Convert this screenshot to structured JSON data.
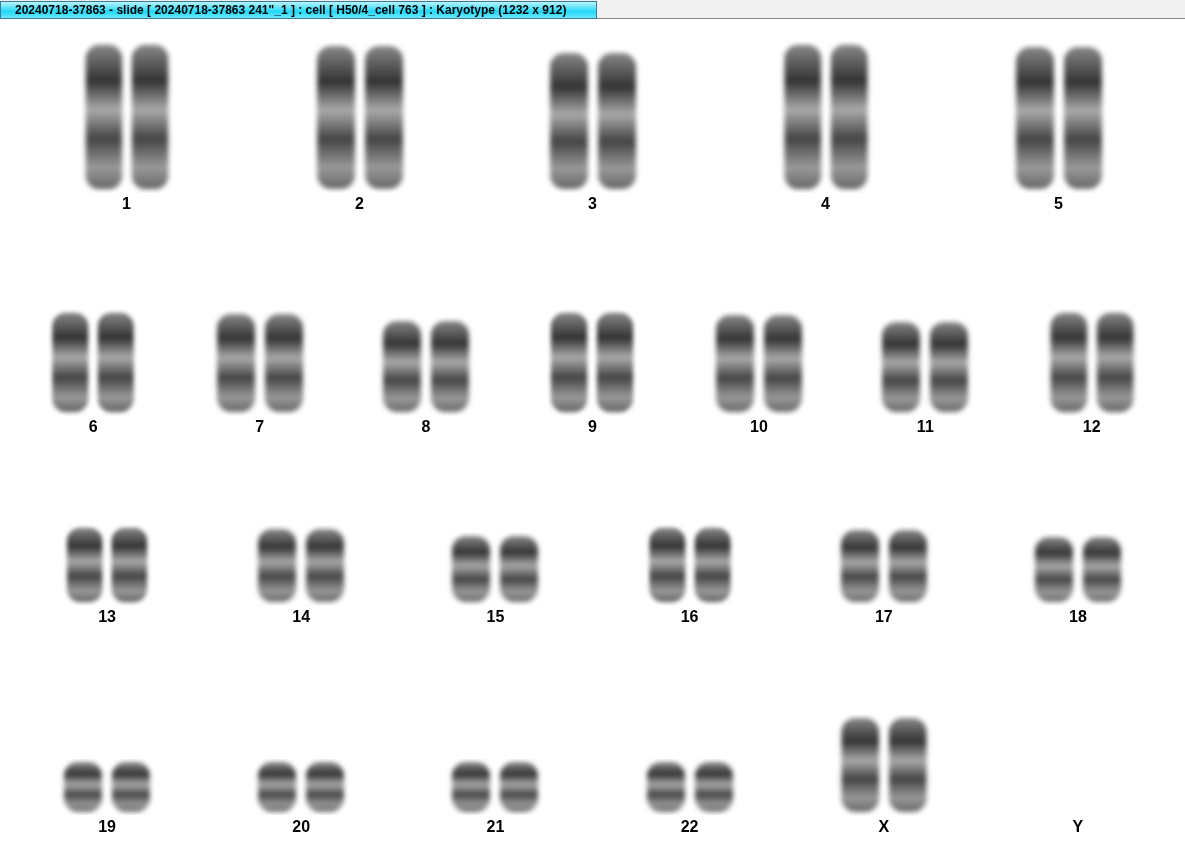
{
  "window": {
    "title": "20240718-37863 - slide [ 20240718-37863 241\"_1 ] : cell [ H50/4_cell 763 ] : Karyotype  (1232 x 912)"
  },
  "karyotype": {
    "rows": [
      {
        "items": [
          {
            "label": "1",
            "kind": "pair"
          },
          {
            "label": "2",
            "kind": "pair"
          },
          {
            "label": "3",
            "kind": "pair"
          },
          {
            "label": "4",
            "kind": "pair"
          },
          {
            "label": "5",
            "kind": "pair"
          }
        ]
      },
      {
        "items": [
          {
            "label": "6",
            "kind": "pair"
          },
          {
            "label": "7",
            "kind": "pair"
          },
          {
            "label": "8",
            "kind": "pair"
          },
          {
            "label": "9",
            "kind": "pair"
          },
          {
            "label": "10",
            "kind": "pair"
          },
          {
            "label": "11",
            "kind": "pair"
          },
          {
            "label": "12",
            "kind": "pair"
          }
        ]
      },
      {
        "items": [
          {
            "label": "13",
            "kind": "pair"
          },
          {
            "label": "14",
            "kind": "pair"
          },
          {
            "label": "15",
            "kind": "pair"
          },
          {
            "label": "16",
            "kind": "pair"
          },
          {
            "label": "17",
            "kind": "pair"
          },
          {
            "label": "18",
            "kind": "pair"
          }
        ]
      },
      {
        "items": [
          {
            "label": "19",
            "kind": "pair"
          },
          {
            "label": "20",
            "kind": "pair"
          },
          {
            "label": "21",
            "kind": "pair"
          },
          {
            "label": "22",
            "kind": "pair"
          },
          {
            "label": "X",
            "kind": "pair"
          },
          {
            "label": "Y",
            "kind": "empty"
          }
        ]
      }
    ]
  }
}
